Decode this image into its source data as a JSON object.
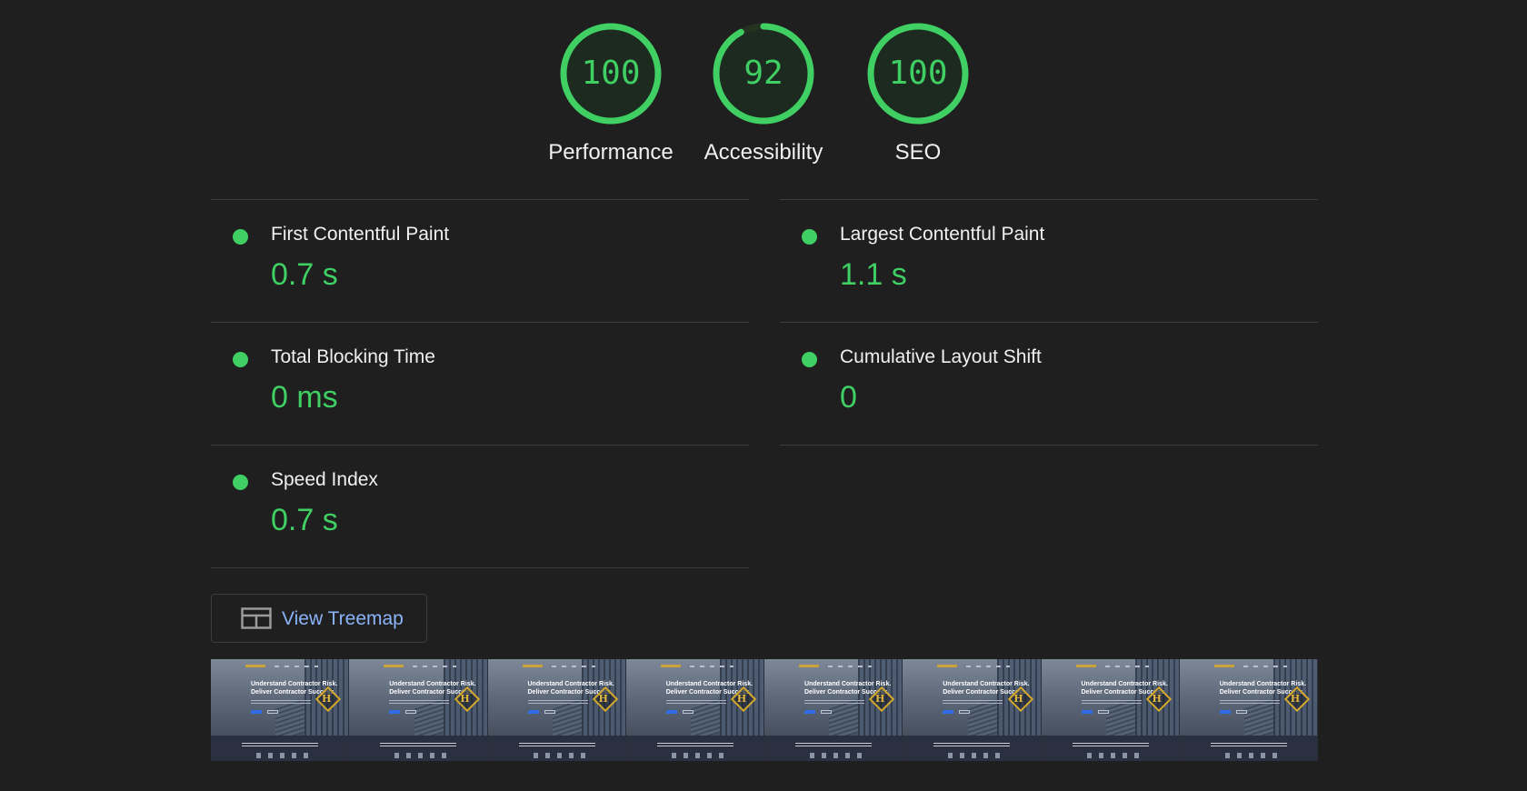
{
  "colors": {
    "background": "#1f1f1f",
    "pass_green": "#3fcf63",
    "text": "#f0f0f0",
    "divider": "#3c3c3c",
    "link_blue": "#8ab4f8"
  },
  "gauges": [
    {
      "score": "100",
      "value": 100,
      "label": "Performance"
    },
    {
      "score": "92",
      "value": 92,
      "label": "Accessibility"
    },
    {
      "score": "100",
      "value": 100,
      "label": "SEO"
    }
  ],
  "metrics": [
    {
      "title": "First Contentful Paint",
      "value": "0.7 s",
      "status": "pass"
    },
    {
      "title": "Largest Contentful Paint",
      "value": "1.1 s",
      "status": "pass"
    },
    {
      "title": "Total Blocking Time",
      "value": "0 ms",
      "status": "pass"
    },
    {
      "title": "Cumulative Layout Shift",
      "value": "0",
      "status": "pass"
    },
    {
      "title": "Speed Index",
      "value": "0.7 s",
      "status": "pass"
    }
  ],
  "treemap_button": {
    "label": "View Treemap",
    "icon": "treemap-icon"
  },
  "filmstrip": {
    "frame_count": 8,
    "frame_headline": "Understand Contractor Risk.\nDeliver Contractor Success.",
    "badge_letter": "H"
  }
}
